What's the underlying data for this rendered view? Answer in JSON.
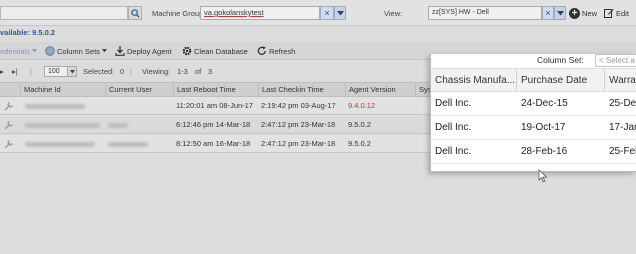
{
  "topbar": {
    "machine_group_label": "Machine Group:",
    "machine_group_value": "va.gokolanskytest",
    "view_label": "View:",
    "view_value": "zz[SYS] HW - Dell",
    "new_label": "New",
    "edit_label": "Edit"
  },
  "available_text": "vailable: 9.5.0.2",
  "toolbar": {
    "credentials_label": "edentials",
    "column_sets_label": "Column Sets",
    "deploy_agent_label": "Deploy Agent",
    "clean_database_label": "Clean Database",
    "refresh_label": "Refresh"
  },
  "pager": {
    "page_size": "100",
    "selected_label": "Selected:",
    "selected_count": "0",
    "viewing_label": "Viewing:",
    "viewing_range": "1-3",
    "of_label": "of",
    "total": "3"
  },
  "grid": {
    "columns": [
      "Machine Id",
      "Current User",
      "Last Reboot Time",
      "Last Checkin Time",
      "Agent Version",
      "Sys"
    ],
    "rows": [
      {
        "last_reboot": "11:20:01 am 08-Jun-17",
        "last_checkin": "2:19:42 pm 03-Aug-17",
        "agent_version": "9.4.0.12",
        "version_outdated": true
      },
      {
        "last_reboot": "6:12:46 pm 14-Mar-18",
        "last_checkin": "2:47:12 pm 23-Mar-18",
        "agent_version": "9.5.0.2",
        "version_outdated": false
      },
      {
        "last_reboot": "8:12:50 am 16-Mar-18",
        "last_checkin": "2:47:12 pm 23-Mar-18",
        "agent_version": "9.5.0.2",
        "version_outdated": false
      }
    ]
  },
  "popup": {
    "column_set_label": "Column Set:",
    "column_set_placeholder": "< Select a",
    "columns": [
      "Chassis Manufa...",
      "Purchase Date",
      "Warra"
    ],
    "rows": [
      {
        "manufacturer": "Dell Inc.",
        "purchase_date": "24-Dec-15",
        "warranty": "25-De"
      },
      {
        "manufacturer": "Dell Inc.",
        "purchase_date": "19-Oct-17",
        "warranty": "17-Jan"
      },
      {
        "manufacturer": "Dell Inc.",
        "purchase_date": "28-Feb-16",
        "warranty": "25-Feb"
      }
    ]
  },
  "colors": {
    "available_text": "#2a5d9a",
    "outdated_version": "#d03030",
    "popup_background": "#ffffff"
  }
}
